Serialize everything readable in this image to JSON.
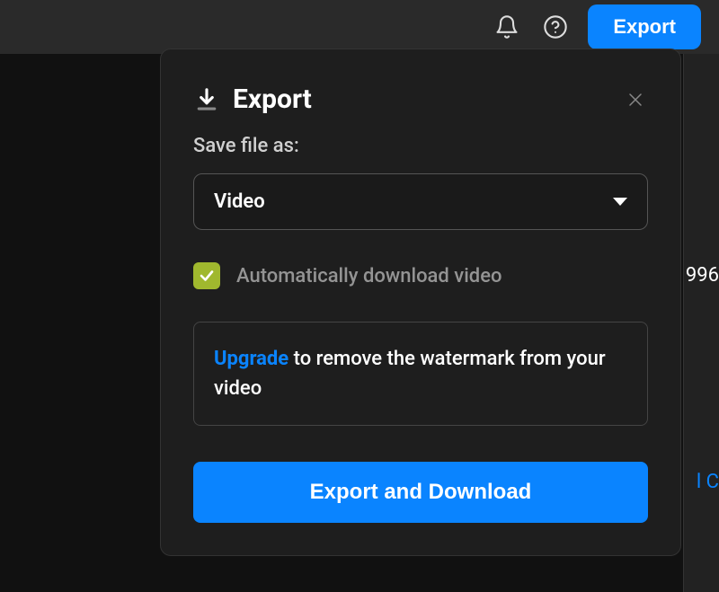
{
  "topbar": {
    "export_label": "Export"
  },
  "background": {
    "partial_text_1": "996",
    "partial_text_2": "l C"
  },
  "dialog": {
    "title": "Export",
    "field_label": "Save file as:",
    "select_value": "Video",
    "checkbox_label": "Automatically download video",
    "upgrade_link": "Upgrade",
    "upgrade_text": " to remove the watermark from your video",
    "export_button": "Export and Download"
  }
}
